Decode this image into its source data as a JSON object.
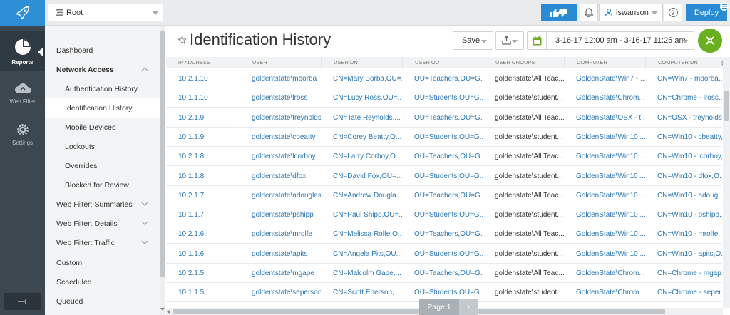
{
  "topbar": {
    "root_label": "Root",
    "username": "iswanson",
    "help_glyph": "?",
    "deploy_label": "Deploy"
  },
  "rail": {
    "items": [
      {
        "label": "Reports",
        "icon": "pie-chart-icon"
      },
      {
        "label": "Web Filter",
        "icon": "cloud-icon"
      },
      {
        "label": "Settings",
        "icon": "gear-icon"
      }
    ]
  },
  "sidebar": {
    "items": [
      {
        "label": "Dashboard"
      },
      {
        "label": "Network Access"
      },
      {
        "label": "Authentication History"
      },
      {
        "label": "Identification History"
      },
      {
        "label": "Mobile Devices"
      },
      {
        "label": "Lockouts"
      },
      {
        "label": "Overrides"
      },
      {
        "label": "Blocked for Review"
      },
      {
        "label": "Web Filter: Summaries"
      },
      {
        "label": "Web Filter: Details"
      },
      {
        "label": "Web Filter: Traffic"
      },
      {
        "label": "Custom"
      },
      {
        "label": "Scheduled"
      },
      {
        "label": "Queued"
      }
    ]
  },
  "main": {
    "title": "Identification History",
    "save_label": "Save",
    "date_range": "3-16-17 12:00 am - 3-16-17 11:25 am"
  },
  "table": {
    "columns": [
      "IP Address",
      "User",
      "User DN",
      "User OU",
      "User Groups",
      "Computer",
      "Computer DN"
    ],
    "rows": [
      [
        "10.2.1.10",
        "goldentstate\\mborba",
        "CN=Mary Borba,OU=...",
        "OU=Teachers,OU=G...",
        "goldenstate\\All Teac...",
        "GoldenState\\Win7 - ...",
        "CN=Win7 - mborba,..."
      ],
      [
        "10.1.1.10",
        "goldentstate\\lross",
        "CN=Lucy Ross,OU=...",
        "OU=Students,OU=G...",
        "goldenstate\\student...",
        "GoldenState\\Chrom...",
        "CN=Chrome - lross,..."
      ],
      [
        "10.2.1.9",
        "goldentstate\\treynolds",
        "CN=Tate Reynolds,...",
        "OU=Teachers,OU=G...",
        "goldenstate\\All Teac...",
        "GoldenState\\OSX - t...",
        "CN=OSX - treynolds..."
      ],
      [
        "10.1.1.9",
        "goldentstate\\cbeatty",
        "CN=Corey Beatty,O...",
        "OU=Students,OU=G...",
        "goldenstate\\student...",
        "GoldenState\\Win10 ...",
        "CN=Win10 - cbeatty,..."
      ],
      [
        "10.2.1.8",
        "goldentstate\\lcorboy",
        "CN=Larry Corboy,O...",
        "OU=Teachers,OU=G...",
        "goldenstate\\All Teac...",
        "GoldenState\\Win10 ...",
        "CN=Win10 - lcorboy,..."
      ],
      [
        "10.1.1.8",
        "goldentstate\\dfox",
        "CN=David Fox,OU=...",
        "OU=Students,OU=G...",
        "goldenstate\\student...",
        "GoldenState\\Win10 ...",
        "CN=Win10 - dfox,O..."
      ],
      [
        "10.2.1.7",
        "goldentstate\\adouglas",
        "CN=Andrew Dougla...",
        "OU=Teachers,OU=G...",
        "goldenstate\\All Teac...",
        "GoldenState\\Win10 ...",
        "CN=Win10 - adougl..."
      ],
      [
        "10.1.1.7",
        "goldentstate\\pshipp",
        "CN=Paul Shipp,OU=...",
        "OU=Students,OU=G...",
        "goldenstate\\student...",
        "GoldenState\\Win10 ...",
        "CN=Win10 - pshipp,..."
      ],
      [
        "10.2.1.6",
        "goldentstate\\mrolfe",
        "CN=Melissa Rolfe,O...",
        "OU=Teachers,OU=G...",
        "goldenstate\\All Teac...",
        "GoldenState\\Win10 ...",
        "CN=Win10 - mrolfe,..."
      ],
      [
        "10.1.1.6",
        "goldentstate\\apits",
        "CN=Angela Pits,OU...",
        "OU=Students,OU=G...",
        "goldenstate\\student...",
        "GoldenState\\Win10 ...",
        "CN=Win10 - apits,O..."
      ],
      [
        "10.2.1.5",
        "goldentstate\\mgape",
        "CN=Malcolm Gape,...",
        "OU=Teachers,OU=G...",
        "goldenstate\\All Teac...",
        "GoldenState\\Chrom...",
        "CN=Chrome - mgap..."
      ],
      [
        "10.1.1.5",
        "goldentstate\\seperson",
        "CN=Scott Eperson,...",
        "OU=Students,OU=G...",
        "goldenstate\\student...",
        "GoldenState\\Chrom...",
        "CN=Chrome - seper..."
      ]
    ]
  },
  "pager": {
    "label": "Page 1",
    "next_glyph": "›"
  },
  "colors": {
    "accent": "#2a8ad4",
    "rail_bg": "#3d4750",
    "link": "#2a76b4",
    "fab": "#6aaf1f"
  }
}
